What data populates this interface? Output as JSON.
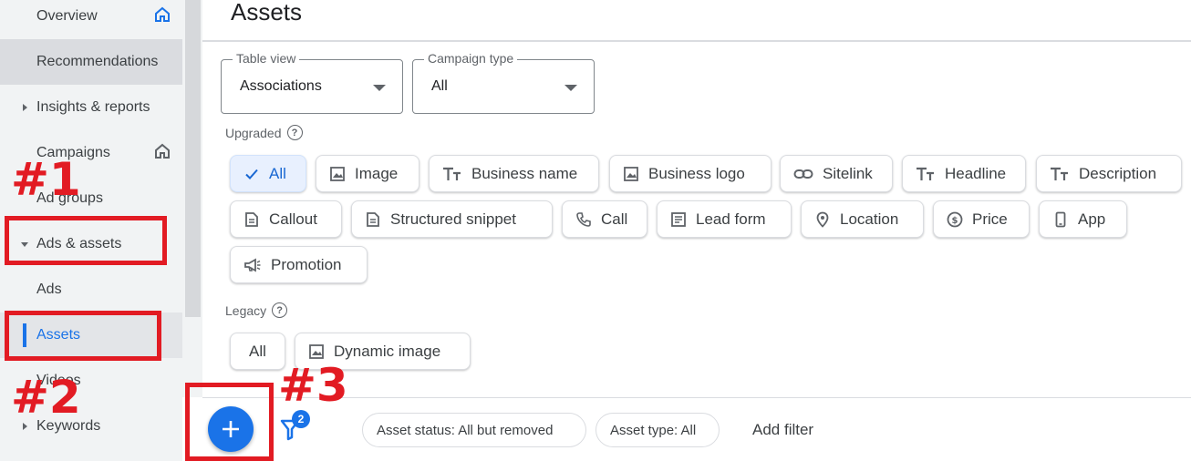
{
  "sidebar": {
    "items": [
      {
        "label": "Overview"
      },
      {
        "label": "Recommendations"
      },
      {
        "label": "Insights & reports"
      },
      {
        "label": "Campaigns"
      },
      {
        "label": "Ad groups"
      },
      {
        "label": "Ads & assets"
      },
      {
        "label": "Ads"
      },
      {
        "label": "Assets"
      },
      {
        "label": "Videos"
      },
      {
        "label": "Keywords"
      }
    ]
  },
  "header": {
    "title": "Assets"
  },
  "filters": {
    "table_view": {
      "legend": "Table view",
      "value": "Associations"
    },
    "campaign_type": {
      "legend": "Campaign type",
      "value": "All"
    }
  },
  "upgraded": {
    "label": "Upgraded",
    "chips": [
      {
        "label": "All",
        "icon": "check-icon",
        "selected": true
      },
      {
        "label": "Image",
        "icon": "image-icon"
      },
      {
        "label": "Business name",
        "icon": "text-icon"
      },
      {
        "label": "Business logo",
        "icon": "image-icon"
      },
      {
        "label": "Sitelink",
        "icon": "link-icon"
      },
      {
        "label": "Headline",
        "icon": "text-icon"
      },
      {
        "label": "Description",
        "icon": "text-icon"
      },
      {
        "label": "Callout",
        "icon": "document-icon"
      },
      {
        "label": "Structured snippet",
        "icon": "document-icon"
      },
      {
        "label": "Call",
        "icon": "phone-icon"
      },
      {
        "label": "Lead form",
        "icon": "form-icon"
      },
      {
        "label": "Location",
        "icon": "location-pin-icon"
      },
      {
        "label": "Price",
        "icon": "price-icon"
      },
      {
        "label": "App",
        "icon": "mobile-icon"
      },
      {
        "label": "Promotion",
        "icon": "megaphone-icon"
      }
    ]
  },
  "legacy": {
    "label": "Legacy",
    "chips": [
      {
        "label": "All"
      },
      {
        "label": "Dynamic image",
        "icon": "image-icon"
      }
    ]
  },
  "toolbar": {
    "filter_count": "2",
    "pills": [
      {
        "label": "Asset status: All but removed"
      },
      {
        "label": "Asset type: All"
      }
    ],
    "add_filter": "Add filter"
  },
  "annotations": {
    "a1": "#1",
    "a2": "#2",
    "a3": "#3"
  },
  "colors": {
    "accent": "#1a73e8",
    "annotation": "#e21b23"
  }
}
